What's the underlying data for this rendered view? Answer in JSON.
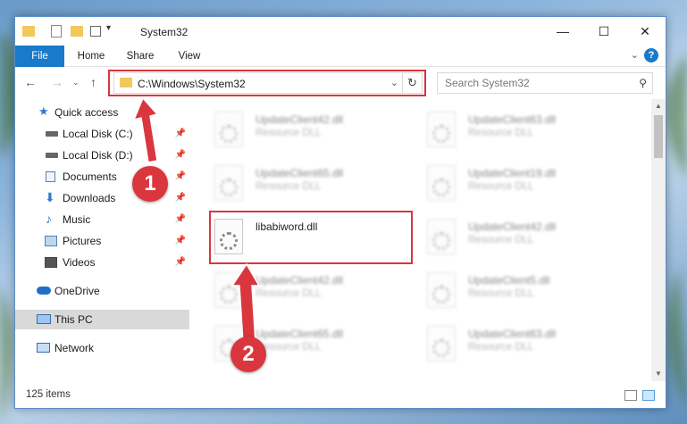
{
  "window": {
    "title": "System32",
    "controls": {
      "minimize": "—",
      "maximize": "☐",
      "close": "✕"
    }
  },
  "ribbon": {
    "tabs": [
      "File",
      "Home",
      "Share",
      "View"
    ],
    "expand": "⌄",
    "help": "?"
  },
  "address": {
    "path": "C:\\Windows\\System32",
    "search_placeholder": "Search System32"
  },
  "nav": {
    "items": [
      {
        "label": "Quick access",
        "icon": "star-icon"
      },
      {
        "label": "Local Disk (C:)",
        "icon": "drive-icon",
        "pinned": true
      },
      {
        "label": "Local Disk (D:)",
        "icon": "drive-icon",
        "pinned": true
      },
      {
        "label": "Documents",
        "icon": "documents-icon",
        "pinned": true
      },
      {
        "label": "Downloads",
        "icon": "downloads-icon",
        "pinned": true
      },
      {
        "label": "Music",
        "icon": "music-icon",
        "pinned": true
      },
      {
        "label": "Pictures",
        "icon": "pictures-icon",
        "pinned": true
      },
      {
        "label": "Videos",
        "icon": "videos-icon",
        "pinned": true
      },
      {
        "label": "OneDrive",
        "icon": "cloud-icon"
      },
      {
        "label": "This PC",
        "icon": "computer-icon",
        "selected": true
      },
      {
        "label": "Network",
        "icon": "network-icon"
      }
    ]
  },
  "files": [
    {
      "name": "UpdateClient42.dll",
      "type": "Resource DLL",
      "blurred": true
    },
    {
      "name": "UpdateClient63.dll",
      "type": "Resource DLL",
      "blurred": true
    },
    {
      "name": "UpdateClient65.dll",
      "type": "Resource DLL",
      "blurred": true
    },
    {
      "name": "UpdateClient19.dll",
      "type": "Resource DLL",
      "blurred": true
    },
    {
      "name": "libabiword.dll",
      "type": "",
      "blurred": false
    },
    {
      "name": "UpdateClient42.dll",
      "type": "Resource DLL",
      "blurred": true
    },
    {
      "name": "UpdateClient42.dll",
      "type": "Resource DLL",
      "blurred": true
    },
    {
      "name": "UpdateClient5.dll",
      "type": "Resource DLL",
      "blurred": true
    },
    {
      "name": "UpdateClient65.dll",
      "type": "Resource DLL",
      "blurred": true
    },
    {
      "name": "UpdateClient63.dll",
      "type": "Resource DLL",
      "blurred": true
    }
  ],
  "status": {
    "item_count": "125 items"
  },
  "annotations": {
    "step1": "1",
    "step2": "2",
    "color": "#d9363e"
  }
}
